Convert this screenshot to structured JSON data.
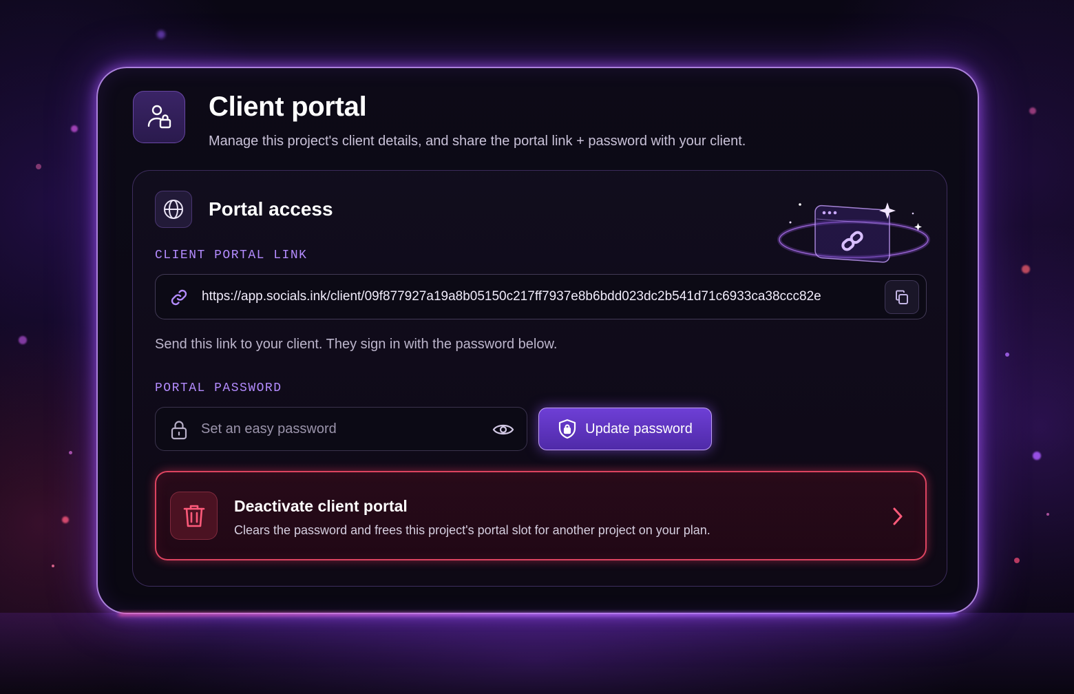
{
  "header": {
    "title": "Client portal",
    "subtitle": "Manage this project's client details, and share the portal link + password with your client.",
    "icon": "user-lock-icon"
  },
  "portal_access": {
    "title": "Portal access",
    "icon": "globe-icon",
    "link_label": "CLIENT PORTAL LINK",
    "link_value": "https://app.socials.ink/client/09f877927a19a8b05150c217ff7937e8b6bdd023dc2b541d71c6933ca38ccc82e",
    "link_icon": "link-icon",
    "copy_icon": "copy-icon",
    "link_help": "Send this link to your client. They sign in with the password below.",
    "password_label": "PORTAL PASSWORD",
    "password_placeholder": "Set an easy password",
    "password_value": "",
    "lock_icon": "lock-icon",
    "eye_icon": "eye-icon",
    "update_button_label": "Update password",
    "update_button_icon": "shield-lock-icon"
  },
  "danger_zone": {
    "title": "Deactivate client portal",
    "description": "Clears the password and frees this project's portal slot for another project on your plan.",
    "icon": "trash-icon",
    "chevron_icon": "chevron-right-icon"
  },
  "colors": {
    "accent": "#b48cff",
    "button": "#5e35c0",
    "danger": "#ff5070",
    "background": "#07050d",
    "card": "#0d0a17"
  }
}
